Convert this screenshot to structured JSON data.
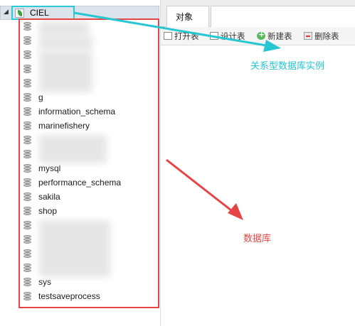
{
  "navigator": {
    "connection": {
      "name": "CIEL",
      "icon": "navicat-leaf-icon",
      "expanded_indicator": "◢"
    },
    "databases": [
      {
        "label": "",
        "redacted": true
      },
      {
        "label": "",
        "redacted": true
      },
      {
        "label": "",
        "redacted": true
      },
      {
        "label": "",
        "redacted": true
      },
      {
        "label": "",
        "redacted": true
      },
      {
        "label": "g",
        "redacted": true
      },
      {
        "label": "information_schema",
        "redacted": false
      },
      {
        "label": "marinefishery",
        "redacted": false
      },
      {
        "label": "",
        "redacted": true
      },
      {
        "label": "",
        "redacted": true
      },
      {
        "label": "mysql",
        "redacted": false
      },
      {
        "label": "performance_schema",
        "redacted": false
      },
      {
        "label": "sakila",
        "redacted": false
      },
      {
        "label": "shop",
        "redacted": false
      },
      {
        "label": "",
        "redacted": true
      },
      {
        "label": "",
        "redacted": true
      },
      {
        "label": "",
        "redacted": true
      },
      {
        "label": "",
        "redacted": true
      },
      {
        "label": "sys",
        "redacted": false
      },
      {
        "label": "testsaveprocess",
        "redacted": false
      }
    ]
  },
  "tabs": {
    "objects": "对象"
  },
  "toolbar": {
    "open_table": "打开表",
    "design_table": "设计表",
    "new_table": "新建表",
    "delete_table": "删除表"
  },
  "annotations": {
    "relational_instance": "关系型数据库实例",
    "database": "数据库"
  },
  "colors": {
    "annotation_cyan": "#27c6d3",
    "annotation_red": "#e64545"
  }
}
